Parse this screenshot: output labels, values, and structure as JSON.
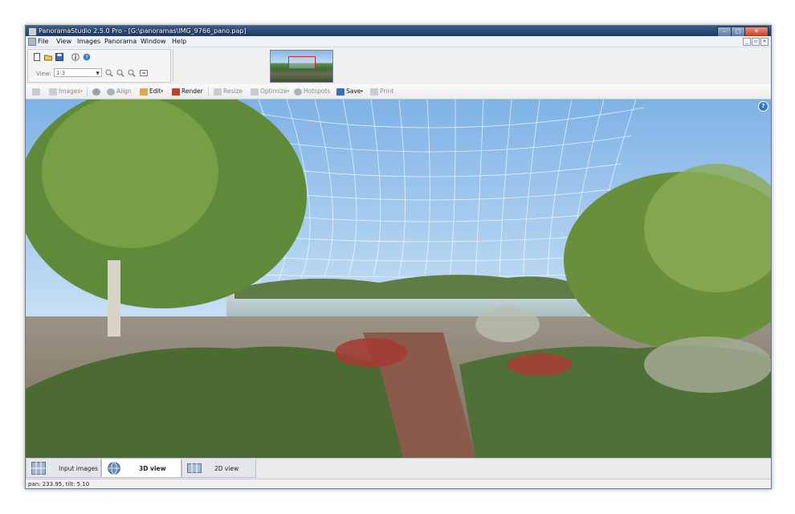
{
  "window": {
    "title": "PanoramaStudio 2.5.0 Pro - [G:\\panoramas\\IMG_9766_pano.pap]"
  },
  "menu": [
    "File",
    "View",
    "Images",
    "Panorama",
    "Window",
    "Help"
  ],
  "toolpanel": {
    "view_label": "View:",
    "zoom_value": "1:3",
    "icons": [
      "new-icon",
      "open-icon",
      "save-icon",
      "info-icon",
      "help-icon",
      "zoom-in-icon",
      "zoom-out-icon",
      "zoom-fit-icon",
      "zoom-actual-icon"
    ]
  },
  "toolbar": {
    "images": "Images",
    "align": "Align",
    "edit": "Edit",
    "render": "Render",
    "resize": "Resize",
    "optimize": "Optimize",
    "hotspots": "Hotspots",
    "save": "Save",
    "print": "Print"
  },
  "tabs": [
    {
      "label": "Input images",
      "active": false
    },
    {
      "label": "3D view",
      "active": true
    },
    {
      "label": "2D view",
      "active": false
    }
  ],
  "status": {
    "text": "pan: 233.95, tilt: 5.10"
  },
  "colors": {
    "titlebar": "#2a4872",
    "sky": "#9cc6ec",
    "grid": "#ffffff",
    "close_button": "#c33d21"
  }
}
